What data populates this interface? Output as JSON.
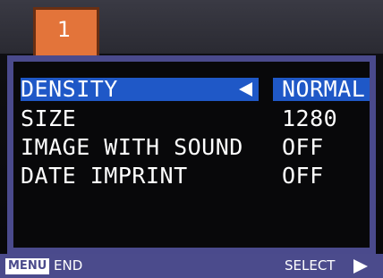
{
  "tab": {
    "number": "1"
  },
  "menu": {
    "items": [
      {
        "label": "DENSITY",
        "value": "NORMAL",
        "selected": true
      },
      {
        "label": "SIZE",
        "value": "1280",
        "selected": false
      },
      {
        "label": "IMAGE WITH SOUND",
        "value": "OFF",
        "selected": false
      },
      {
        "label": "DATE IMPRINT",
        "value": "OFF",
        "selected": false
      }
    ]
  },
  "footer": {
    "menu_button": "MENU",
    "end_label": "END",
    "select_label": "SELECT"
  },
  "colors": {
    "tab": "#e3743a",
    "highlight": "#1f58c7",
    "frame": "#4a4a8c",
    "footer": "#4b4b8c"
  }
}
